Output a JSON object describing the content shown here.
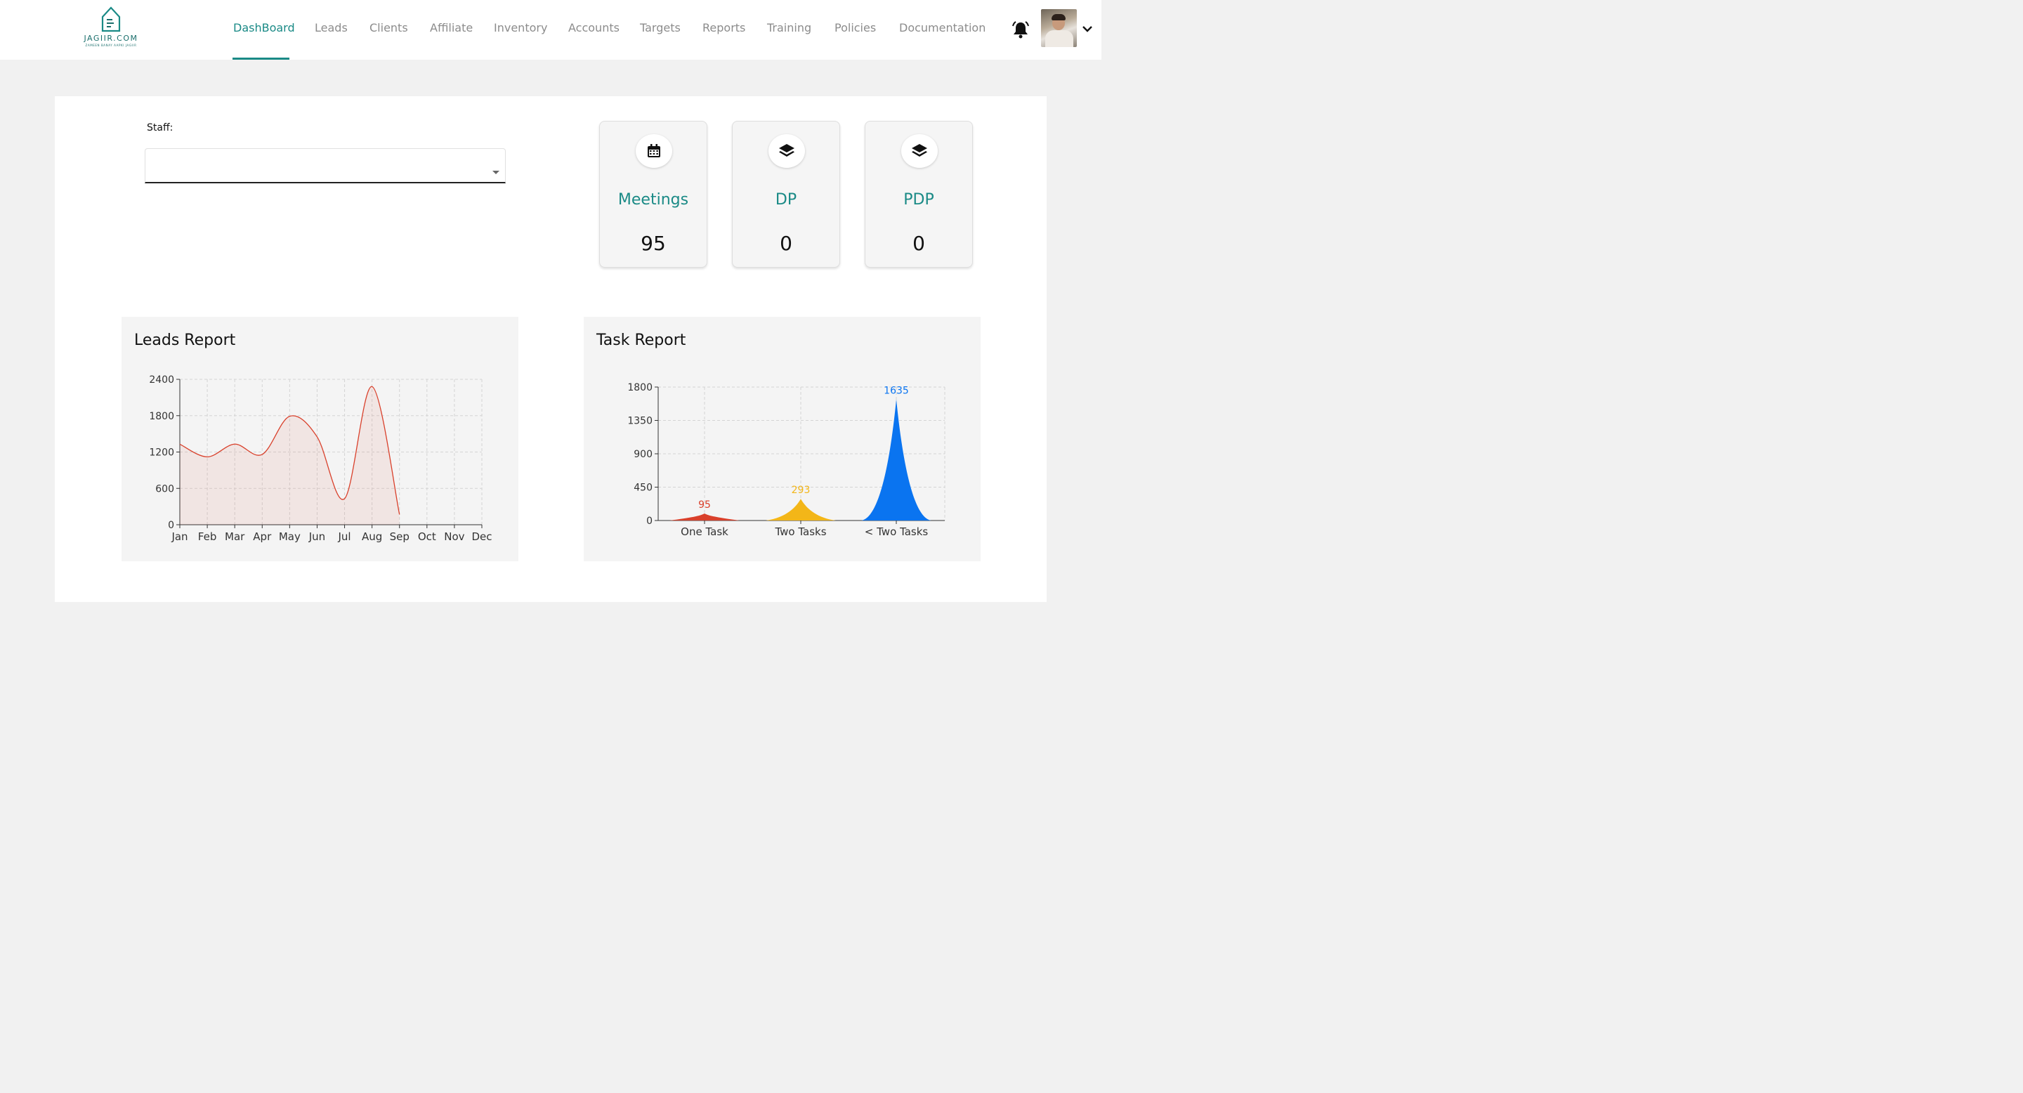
{
  "brand": {
    "name": "JAGIIR.COM",
    "tagline": "ZAMEEN BANAY AAPKI JAGIIR"
  },
  "nav": {
    "items": [
      {
        "label": "DashBoard",
        "active": true
      },
      {
        "label": "Leads"
      },
      {
        "label": "Clients"
      },
      {
        "label": "Affiliate"
      },
      {
        "label": "Inventory"
      },
      {
        "label": "Accounts"
      },
      {
        "label": "Targets"
      },
      {
        "label": "Reports"
      },
      {
        "label": "Training"
      },
      {
        "label": "Policies"
      },
      {
        "label": "Documentation"
      }
    ]
  },
  "header": {
    "icons": [
      "bell-icon",
      "avatar",
      "chevron-down-icon"
    ]
  },
  "filter": {
    "label": "Staff:",
    "value": ""
  },
  "stats": [
    {
      "title": "Meetings",
      "value": "95",
      "icon": "calendar-icon"
    },
    {
      "title": "DP",
      "value": "0",
      "icon": "layers-icon"
    },
    {
      "title": "PDP",
      "value": "0",
      "icon": "layers-icon"
    }
  ],
  "colors": {
    "accent": "#1a8a86",
    "leads_line": "#d9402b",
    "one_task": "#d9402b",
    "two_tasks": "#f3b618",
    "lt_two_tasks": "#0a74f0"
  },
  "chart_data": [
    {
      "type": "area",
      "title": "Leads Report",
      "categories": [
        "Jan",
        "Feb",
        "Mar",
        "Apr",
        "May",
        "Jun",
        "Jul",
        "Aug",
        "Sep",
        "Oct",
        "Nov",
        "Dec"
      ],
      "values": [
        1330,
        1120,
        1330,
        1160,
        1790,
        1450,
        430,
        2280,
        170,
        null,
        null,
        null
      ],
      "yticks": [
        0,
        600,
        1200,
        1800,
        2400
      ],
      "ylim": [
        0,
        2400
      ],
      "grid": true
    },
    {
      "type": "area",
      "title": "Task Report",
      "categories": [
        "One Task",
        "Two Tasks",
        "< Two Tasks"
      ],
      "values": [
        95,
        293,
        1635
      ],
      "data_labels": [
        "95",
        "293",
        "1635"
      ],
      "yticks": [
        0,
        450,
        900,
        1350,
        1800
      ],
      "ylim": [
        0,
        1800
      ],
      "grid": true
    }
  ]
}
